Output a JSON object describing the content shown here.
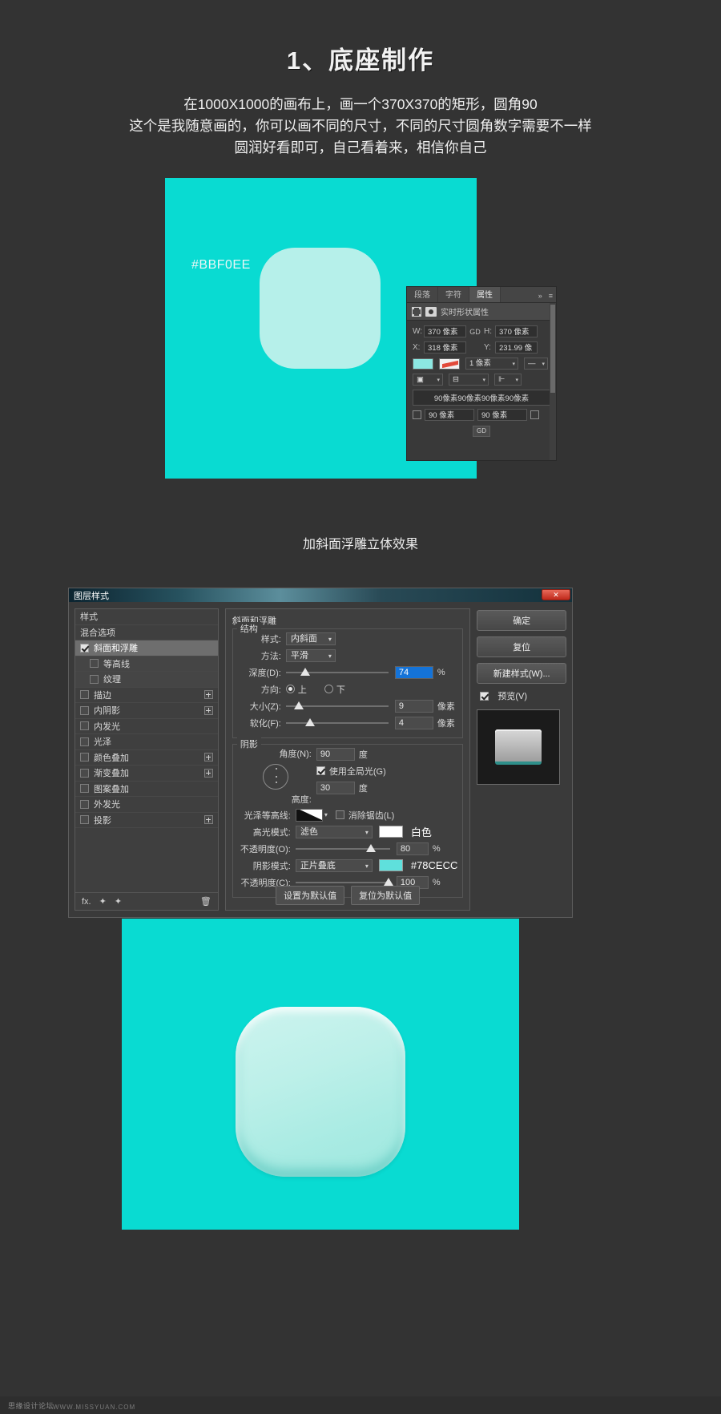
{
  "page": {
    "title": "1、底座制作",
    "intro_lines": [
      "在1000X1000的画布上，画一个370X370的矩形，圆角90",
      "这个是我随意画的，你可以画不同的尺寸，不同的尺寸圆角数字需要不一样",
      "圆润好看即可，自己看着来，相信你自己"
    ],
    "caption": "加斜面浮雕立体效果",
    "watermark": "思缘设计论坛",
    "watermark2": "WWW.MISSYUAN.COM"
  },
  "stage1": {
    "bg_color": "#09DBD2",
    "shape_color_label": "#BBF0EE",
    "shape_fill": "#b6f0ea"
  },
  "stage2": {
    "bg_color": "#09DBD2"
  },
  "properties_panel": {
    "tabs": [
      {
        "label": "段落",
        "active": false
      },
      {
        "label": "字符",
        "active": false
      },
      {
        "label": "属性",
        "active": true
      }
    ],
    "overflow_icon": "»",
    "menu_icon": "≡",
    "title": "实时形状属性",
    "fields": {
      "w_label": "W:",
      "w_value": "370 像素",
      "link_icon": "GD",
      "h_label": "H:",
      "h_value": "370 像素",
      "x_label": "X:",
      "x_value": "318 像素",
      "y_label": "Y:",
      "y_value": "231.99 像"
    },
    "stroke_width": "1 像素",
    "radius_summary": "90像素90像素90像素90像素",
    "radius_1": "90 像素",
    "radius_2": "90 像素",
    "link_button": "GD"
  },
  "layer_style_dialog": {
    "title": "图层样式",
    "close_label": "✕",
    "style_list": [
      {
        "label": "样式",
        "type": "head",
        "checked": false,
        "plus": false
      },
      {
        "label": "混合选项",
        "type": "head",
        "checked": false,
        "plus": false
      },
      {
        "label": "斜面和浮雕",
        "type": "selected",
        "checked": true,
        "plus": false
      },
      {
        "label": "等高线",
        "type": "sub",
        "checked": false,
        "plus": false
      },
      {
        "label": "纹理",
        "type": "sub",
        "checked": false,
        "plus": false
      },
      {
        "label": "描边",
        "type": "item",
        "checked": false,
        "plus": true
      },
      {
        "label": "内阴影",
        "type": "item",
        "checked": false,
        "plus": true
      },
      {
        "label": "内发光",
        "type": "item",
        "checked": false,
        "plus": false
      },
      {
        "label": "光泽",
        "type": "item",
        "checked": false,
        "plus": false
      },
      {
        "label": "颜色叠加",
        "type": "item",
        "checked": false,
        "plus": true
      },
      {
        "label": "渐变叠加",
        "type": "item",
        "checked": false,
        "plus": true
      },
      {
        "label": "图案叠加",
        "type": "item",
        "checked": false,
        "plus": false
      },
      {
        "label": "外发光",
        "type": "item",
        "checked": false,
        "plus": false
      },
      {
        "label": "投影",
        "type": "item",
        "checked": false,
        "plus": true
      }
    ],
    "list_footer": {
      "fx": "fx.",
      "up": "✦",
      "down": "✦",
      "trash": "🗑"
    },
    "settings": {
      "section_title": "斜面和浮雕",
      "structure_legend": "结构",
      "style_label": "样式:",
      "style_value": "内斜面",
      "method_label": "方法:",
      "method_value": "平滑",
      "depth_label": "深度(D):",
      "depth_value": "74",
      "depth_unit": "%",
      "direction_label": "方向:",
      "direction_up": "上",
      "direction_down": "下",
      "direction_selected": "上",
      "size_label": "大小(Z):",
      "size_value": "9",
      "size_unit": "像素",
      "soften_label": "软化(F):",
      "soften_value": "4",
      "soften_unit": "像素",
      "shading_legend": "阴影",
      "angle_label": "角度(N):",
      "angle_value": "90",
      "angle_unit": "度",
      "global_light_label": "使用全局光(G)",
      "global_light_checked": true,
      "altitude_label": "高度:",
      "altitude_value": "30",
      "altitude_unit": "度",
      "gloss_contour_label": "光泽等高线:",
      "antialias_label": "消除锯齿(L)",
      "antialias_checked": false,
      "highlight_mode_label": "高光模式:",
      "highlight_mode_value": "滤色",
      "highlight_color_name": "白色",
      "highlight_color": "#ffffff",
      "highlight_opacity_label": "不透明度(O):",
      "highlight_opacity_value": "80",
      "highlight_opacity_unit": "%",
      "shadow_mode_label": "阴影模式:",
      "shadow_mode_value": "正片叠底",
      "shadow_color_name": "#78CECC",
      "shadow_color": "#78CECC",
      "shadow_opacity_label": "不透明度(C):",
      "shadow_opacity_value": "100",
      "shadow_opacity_unit": "%",
      "set_default_btn": "设置为默认值",
      "reset_default_btn": "复位为默认值"
    },
    "right_buttons": [
      {
        "label": "确定"
      },
      {
        "label": "复位"
      },
      {
        "label": "新建样式(W)..."
      }
    ],
    "preview_label": "预览(V)",
    "preview_checked": true
  }
}
